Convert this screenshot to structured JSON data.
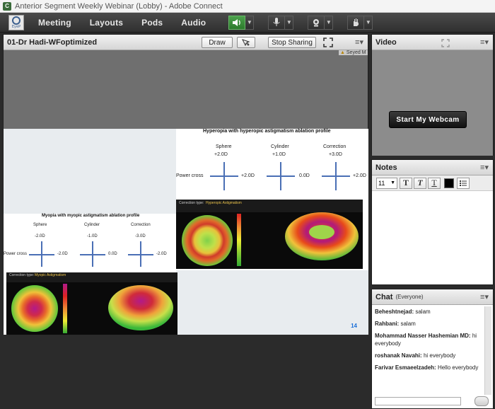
{
  "window": {
    "title": "Anterior Segment Weekly Webinar (Lobby) - Adobe Connect"
  },
  "menu": {
    "items": [
      "Meeting",
      "Layouts",
      "Pods",
      "Audio"
    ]
  },
  "share_pod": {
    "title": "01-Dr Hadi-WFoptimized",
    "draw_label": "Draw",
    "stop_sharing_label": "Stop Sharing",
    "presenter_tag": "Seyed M"
  },
  "slide": {
    "hyperopia": {
      "title": "Hyperopia with hyperopic astigmatism ablation profile",
      "col_labels": [
        "Sphere",
        "Cylinder",
        "Correction"
      ],
      "values": [
        "+2.0D",
        "+1.0D",
        "+3.0D"
      ],
      "row_label": "Power cross",
      "side_values": [
        "+2.0D",
        "0.0D",
        "+2.0D"
      ],
      "correction_type": "Correction type:",
      "correction_name": "Hyperopic Astigmatism"
    },
    "myopia": {
      "title": "Myopia with myopic astigmatism ablation profile",
      "col_labels": [
        "Sphere",
        "Cylinder",
        "Correction"
      ],
      "values": [
        "-2.0D",
        "-1.0D",
        "-3.0D"
      ],
      "row_label": "Power cross",
      "side_values": [
        "-2.0D",
        "0.0D",
        "-2.0D"
      ],
      "correction_type": "Correction type:",
      "correction_name": "Myopic Astigmatism"
    },
    "page_number": "14"
  },
  "video_pod": {
    "title": "Video",
    "start_webcam_label": "Start My Webcam"
  },
  "notes_pod": {
    "title": "Notes",
    "font_size": "11"
  },
  "chat_pod": {
    "title": "Chat",
    "scope": "(Everyone)",
    "messages": [
      {
        "sender": "Beheshtnejad:",
        "text": "salam"
      },
      {
        "sender": "Rahbani:",
        "text": "salam"
      },
      {
        "sender": "Mohammad Nasser Hashemian MD:",
        "text": "hi everybody"
      },
      {
        "sender": "roshanak Navahi:",
        "text": "hi everybody"
      },
      {
        "sender": "Farivar Esmaeelzadeh:",
        "text": "Hello everybody"
      }
    ]
  },
  "colors": {
    "accent_green": "#3c8f3c",
    "cross_blue": "#4a6fb5",
    "page_number_blue": "#1a6fd8"
  },
  "icons": [
    "speaker-icon",
    "microphone-icon",
    "webcam-icon",
    "raise-hand-icon",
    "pointer-icon",
    "fullscreen-icon",
    "pod-menu-icon"
  ]
}
